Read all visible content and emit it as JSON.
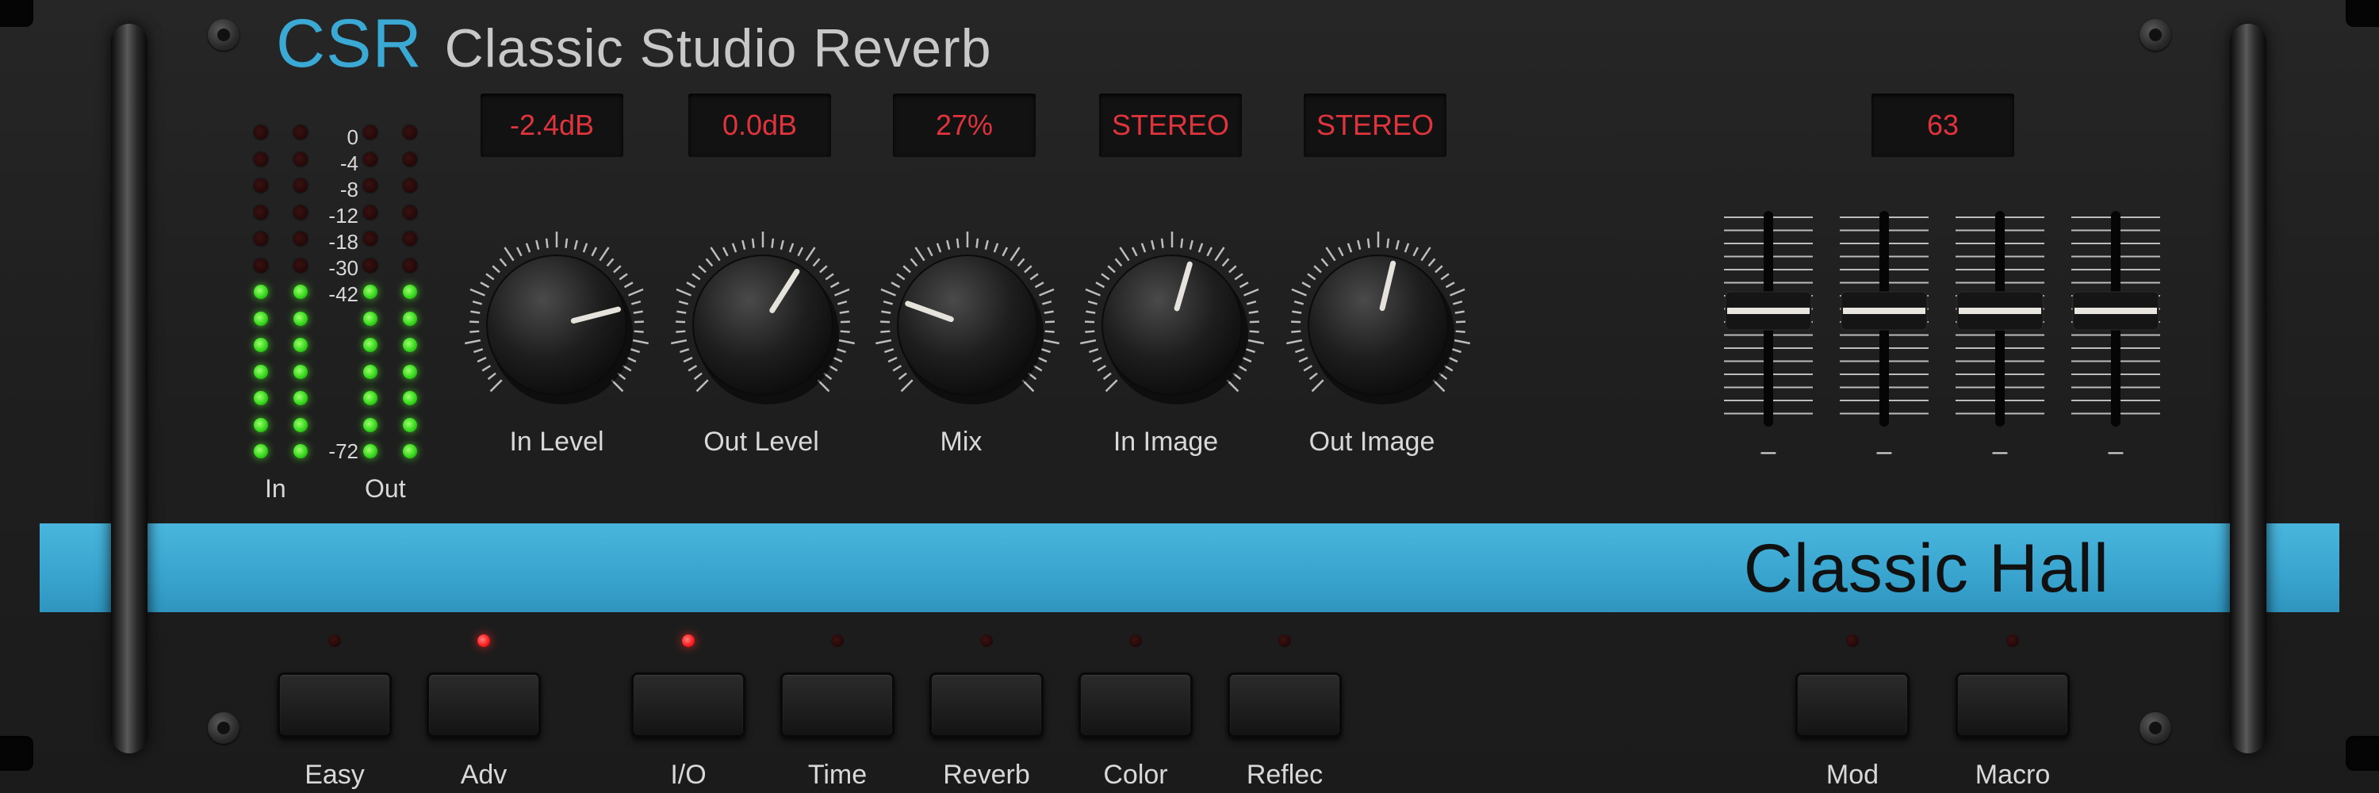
{
  "header": {
    "abbreviation": "CSR",
    "title": "Classic Studio Reverb"
  },
  "meter": {
    "scale": [
      "0",
      "-4",
      "-8",
      "-12",
      "-18",
      "-30",
      "-42",
      "-72"
    ],
    "in_label": "In",
    "out_label": "Out",
    "lit_segments": 7
  },
  "displays": {
    "in_level": "-2.4dB",
    "out_level": "0.0dB",
    "mix": "27%",
    "in_image": "STEREO",
    "out_image": "STEREO",
    "fader_value": "63"
  },
  "knobs": [
    {
      "label": "In Level",
      "value": 0.78
    },
    {
      "label": "Out Level",
      "value": 0.62
    },
    {
      "label": "Mix",
      "value": 0.24
    },
    {
      "label": "In Image",
      "value": 0.56
    },
    {
      "label": "Out Image",
      "value": 0.55
    }
  ],
  "faders": [
    {
      "label": "–",
      "value": 0.5
    },
    {
      "label": "–",
      "value": 0.5
    },
    {
      "label": "–",
      "value": 0.5
    },
    {
      "label": "–",
      "value": 0.5
    }
  ],
  "preset": {
    "name": "Classic Hall"
  },
  "buttons": [
    {
      "label": "Easy",
      "led_on": false
    },
    {
      "label": "Adv",
      "led_on": true
    },
    {
      "label": "I/O",
      "led_on": true
    },
    {
      "label": "Time",
      "led_on": false
    },
    {
      "label": "Reverb",
      "led_on": false
    },
    {
      "label": "Color",
      "led_on": false
    },
    {
      "label": "Reflec",
      "led_on": false
    },
    {
      "label": "Mod",
      "led_on": false
    },
    {
      "label": "Macro",
      "led_on": false
    }
  ],
  "colors": {
    "accent": "#3aa9d4",
    "display_text": "#e0343c",
    "meter_led": "#37d91d",
    "button_led_on": "#ff2020"
  }
}
